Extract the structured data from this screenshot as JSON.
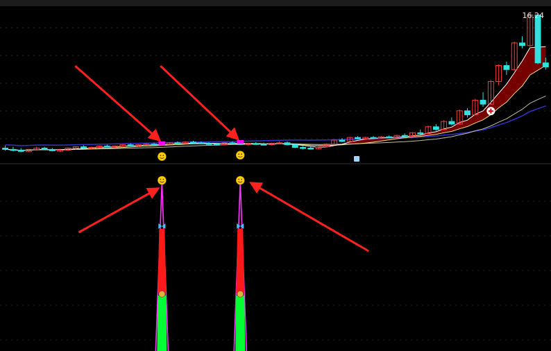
{
  "price_label": "16.24",
  "colors": {
    "up": "#ff3b3b",
    "down": "#33e0e0",
    "ma_short": "#ffffff",
    "ma_mid": "#e8e07a",
    "ma_long": "#3333cc",
    "signal": "#ff00ff",
    "arrow": "#ff2020",
    "bar_red": "#ff1a1a",
    "bar_green": "#00ff33",
    "outline": "#ff33ff"
  },
  "icons": [
    "smiley-icon",
    "butterfly-icon",
    "money-bag-icon",
    "medical-cross-icon",
    "lock-icon"
  ],
  "chart_data": {
    "type": "candlestick",
    "title": "",
    "xlabel": "",
    "ylabel": "",
    "last_price": 16.24,
    "grid": true,
    "candles": [
      {
        "o": 6.1,
        "h": 6.3,
        "l": 5.9,
        "c": 6.0
      },
      {
        "o": 6.0,
        "h": 6.2,
        "l": 5.85,
        "c": 5.95
      },
      {
        "o": 5.95,
        "h": 6.1,
        "l": 5.8,
        "c": 5.85
      },
      {
        "o": 5.85,
        "h": 6.05,
        "l": 5.8,
        "c": 6.0
      },
      {
        "o": 6.0,
        "h": 6.2,
        "l": 5.9,
        "c": 6.1
      },
      {
        "o": 6.1,
        "h": 6.2,
        "l": 5.95,
        "c": 6.0
      },
      {
        "o": 6.0,
        "h": 6.1,
        "l": 5.85,
        "c": 5.9
      },
      {
        "o": 5.9,
        "h": 6.05,
        "l": 5.8,
        "c": 5.95
      },
      {
        "o": 5.95,
        "h": 6.15,
        "l": 5.9,
        "c": 6.1
      },
      {
        "o": 6.1,
        "h": 6.25,
        "l": 6.0,
        "c": 6.2
      },
      {
        "o": 6.2,
        "h": 6.3,
        "l": 6.05,
        "c": 6.1
      },
      {
        "o": 6.1,
        "h": 6.2,
        "l": 6.0,
        "c": 6.15
      },
      {
        "o": 6.15,
        "h": 6.3,
        "l": 6.1,
        "c": 6.25
      },
      {
        "o": 6.25,
        "h": 6.35,
        "l": 6.15,
        "c": 6.2
      },
      {
        "o": 6.2,
        "h": 6.3,
        "l": 6.1,
        "c": 6.25
      },
      {
        "o": 6.25,
        "h": 6.4,
        "l": 6.2,
        "c": 6.35
      },
      {
        "o": 6.35,
        "h": 6.45,
        "l": 6.25,
        "c": 6.3
      },
      {
        "o": 6.3,
        "h": 6.4,
        "l": 6.2,
        "c": 6.35
      },
      {
        "o": 6.35,
        "h": 6.45,
        "l": 6.3,
        "c": 6.4
      },
      {
        "o": 6.4,
        "h": 6.5,
        "l": 6.3,
        "c": 6.35
      },
      {
        "o": 6.35,
        "h": 6.45,
        "l": 6.25,
        "c": 6.4
      },
      {
        "o": 6.4,
        "h": 6.55,
        "l": 6.35,
        "c": 6.5
      },
      {
        "o": 6.5,
        "h": 6.6,
        "l": 6.4,
        "c": 6.45
      },
      {
        "o": 6.45,
        "h": 6.6,
        "l": 6.4,
        "c": 6.55
      },
      {
        "o": 6.55,
        "h": 6.65,
        "l": 6.45,
        "c": 6.5
      },
      {
        "o": 6.5,
        "h": 6.6,
        "l": 6.4,
        "c": 6.45
      },
      {
        "o": 6.45,
        "h": 6.55,
        "l": 6.35,
        "c": 6.4
      },
      {
        "o": 6.4,
        "h": 6.5,
        "l": 6.3,
        "c": 6.35
      },
      {
        "o": 6.35,
        "h": 6.55,
        "l": 6.3,
        "c": 6.5
      },
      {
        "o": 6.5,
        "h": 6.6,
        "l": 6.4,
        "c": 6.45
      },
      {
        "o": 6.45,
        "h": 6.55,
        "l": 6.35,
        "c": 6.4
      },
      {
        "o": 6.4,
        "h": 6.5,
        "l": 6.3,
        "c": 6.45
      },
      {
        "o": 6.45,
        "h": 6.55,
        "l": 6.35,
        "c": 6.4
      },
      {
        "o": 6.4,
        "h": 6.5,
        "l": 6.3,
        "c": 6.35
      },
      {
        "o": 6.35,
        "h": 6.5,
        "l": 6.3,
        "c": 6.45
      },
      {
        "o": 6.45,
        "h": 6.6,
        "l": 6.4,
        "c": 6.5
      },
      {
        "o": 6.5,
        "h": 6.6,
        "l": 6.3,
        "c": 6.35
      },
      {
        "o": 6.35,
        "h": 6.45,
        "l": 6.1,
        "c": 6.15
      },
      {
        "o": 6.15,
        "h": 6.25,
        "l": 6.0,
        "c": 6.1
      },
      {
        "o": 6.1,
        "h": 6.2,
        "l": 6.0,
        "c": 6.05
      },
      {
        "o": 6.05,
        "h": 6.25,
        "l": 6.0,
        "c": 6.2
      },
      {
        "o": 6.2,
        "h": 6.45,
        "l": 6.15,
        "c": 6.4
      },
      {
        "o": 6.4,
        "h": 6.75,
        "l": 6.35,
        "c": 6.7
      },
      {
        "o": 6.7,
        "h": 6.85,
        "l": 6.55,
        "c": 6.6
      },
      {
        "o": 6.6,
        "h": 6.95,
        "l": 6.55,
        "c": 6.9
      },
      {
        "o": 6.9,
        "h": 7.0,
        "l": 6.75,
        "c": 6.8
      },
      {
        "o": 6.8,
        "h": 6.95,
        "l": 6.7,
        "c": 6.9
      },
      {
        "o": 6.9,
        "h": 7.0,
        "l": 6.8,
        "c": 6.85
      },
      {
        "o": 6.85,
        "h": 7.0,
        "l": 6.8,
        "c": 6.95
      },
      {
        "o": 6.95,
        "h": 7.05,
        "l": 6.85,
        "c": 6.9
      },
      {
        "o": 6.9,
        "h": 7.1,
        "l": 6.85,
        "c": 7.05
      },
      {
        "o": 7.05,
        "h": 7.2,
        "l": 6.95,
        "c": 7.0
      },
      {
        "o": 7.0,
        "h": 7.3,
        "l": 6.95,
        "c": 7.25
      },
      {
        "o": 7.25,
        "h": 7.5,
        "l": 7.1,
        "c": 7.2
      },
      {
        "o": 7.2,
        "h": 7.8,
        "l": 7.15,
        "c": 7.7
      },
      {
        "o": 7.7,
        "h": 7.9,
        "l": 7.4,
        "c": 7.5
      },
      {
        "o": 7.5,
        "h": 8.2,
        "l": 7.45,
        "c": 8.1
      },
      {
        "o": 8.1,
        "h": 8.4,
        "l": 7.8,
        "c": 7.9
      },
      {
        "o": 7.9,
        "h": 9.0,
        "l": 7.85,
        "c": 8.9
      },
      {
        "o": 8.9,
        "h": 9.1,
        "l": 8.4,
        "c": 8.6
      },
      {
        "o": 8.6,
        "h": 9.8,
        "l": 8.55,
        "c": 9.7
      },
      {
        "o": 9.7,
        "h": 10.3,
        "l": 9.2,
        "c": 9.4
      },
      {
        "o": 9.4,
        "h": 11.2,
        "l": 9.35,
        "c": 11.1
      },
      {
        "o": 11.1,
        "h": 12.4,
        "l": 10.8,
        "c": 12.3
      },
      {
        "o": 12.3,
        "h": 12.6,
        "l": 11.6,
        "c": 12.0
      },
      {
        "o": 12.0,
        "h": 14.1,
        "l": 11.9,
        "c": 14.0
      },
      {
        "o": 14.0,
        "h": 14.5,
        "l": 13.6,
        "c": 13.8
      },
      {
        "o": 13.8,
        "h": 16.24,
        "l": 13.7,
        "c": 16.1
      },
      {
        "o": 16.1,
        "h": 16.24,
        "l": 12.4,
        "c": 12.5
      },
      {
        "o": 12.5,
        "h": 12.9,
        "l": 12.0,
        "c": 12.2
      }
    ],
    "ylim": [
      5.5,
      16.6
    ],
    "signals": [
      {
        "index": 20,
        "markers": [
          "smiley"
        ],
        "subpanel_bar": {
          "red": 0.55,
          "green": 0.45
        }
      },
      {
        "index": 30,
        "markers": [
          "smiley"
        ],
        "subpanel_bar": {
          "red": 0.55,
          "green": 0.45
        }
      }
    ]
  }
}
